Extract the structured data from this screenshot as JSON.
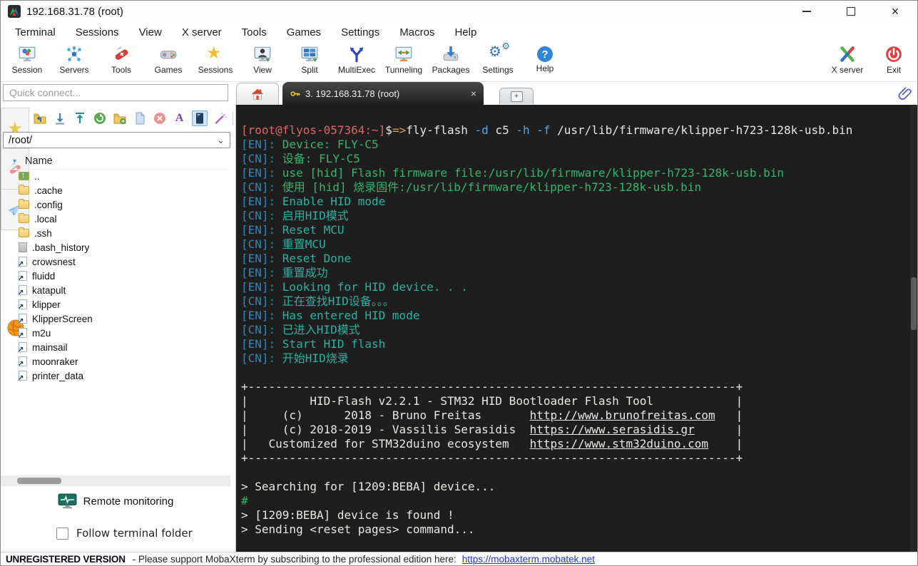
{
  "window": {
    "title": "192.168.31.78 (root)"
  },
  "icons": {
    "close_glyph": "×",
    "plus_glyph": "+",
    "sort_glyph": "▾",
    "chevron_glyph": "⌄",
    "star_glyph": "★",
    "gear_glyph": "⚙",
    "help_glyph": "?",
    "rename_glyph": "A"
  },
  "menu": {
    "items": [
      "Terminal",
      "Sessions",
      "View",
      "X server",
      "Tools",
      "Games",
      "Settings",
      "Macros",
      "Help"
    ]
  },
  "toolbar": {
    "items": [
      {
        "label": "Session"
      },
      {
        "label": "Servers"
      },
      {
        "label": "Tools"
      },
      {
        "label": "Games"
      },
      {
        "label": "Sessions"
      },
      {
        "label": "View"
      },
      {
        "label": "Split"
      },
      {
        "label": "MultiExec"
      },
      {
        "label": "Tunneling"
      },
      {
        "label": "Packages"
      },
      {
        "label": "Settings"
      },
      {
        "label": "Help"
      }
    ],
    "right_items": [
      {
        "label": "X server"
      },
      {
        "label": "Exit"
      }
    ]
  },
  "quick_connect": {
    "placeholder": "Quick connect..."
  },
  "tabs": {
    "active_label": "3. 192.168.31.78 (root)"
  },
  "sidebar": {
    "path": "/root/",
    "name_header": "Name",
    "files": [
      {
        "name": "..",
        "type": "parent"
      },
      {
        "name": ".cache",
        "type": "folder"
      },
      {
        "name": ".config",
        "type": "folder"
      },
      {
        "name": ".local",
        "type": "folder"
      },
      {
        "name": ".ssh",
        "type": "folder"
      },
      {
        "name": ".bash_history",
        "type": "file"
      },
      {
        "name": "crowsnest",
        "type": "link"
      },
      {
        "name": "fluidd",
        "type": "link"
      },
      {
        "name": "katapult",
        "type": "link"
      },
      {
        "name": "klipper",
        "type": "link"
      },
      {
        "name": "KlipperScreen",
        "type": "link"
      },
      {
        "name": "m2u",
        "type": "link"
      },
      {
        "name": "mainsail",
        "type": "link"
      },
      {
        "name": "moonraker",
        "type": "link"
      },
      {
        "name": "printer_data",
        "type": "link"
      }
    ],
    "remote_monitoring": "Remote monitoring",
    "follow_terminal_folder": "Follow terminal folder"
  },
  "terminal": {
    "colors": {
      "background": "#1e1e1e",
      "red": "#e0646c",
      "yellow": "#d4a45a",
      "blue": "#58a6e4",
      "label_blue": "#2e86b8",
      "green": "#35b56e",
      "teal": "#2ab3a0",
      "white": "#e8e8e3"
    },
    "lines": [
      [
        {
          "t": "[root@flyos-057364:~]",
          "c": "red"
        },
        {
          "t": "$",
          "c": "white"
        },
        {
          "t": "=>",
          "c": "yellow"
        },
        {
          "t": "fly-flash ",
          "c": "white"
        },
        {
          "t": "-d",
          "c": "blue"
        },
        {
          "t": " c5 ",
          "c": "white"
        },
        {
          "t": "-h",
          "c": "blue"
        },
        {
          "t": " ",
          "c": "white"
        },
        {
          "t": "-f",
          "c": "blue"
        },
        {
          "t": " /usr/lib/firmware/klipper-h723-128k-usb.bin",
          "c": "white"
        }
      ],
      [
        {
          "t": "[EN]: ",
          "c": "label"
        },
        {
          "t": "Device: FLY-C5",
          "c": "green"
        }
      ],
      [
        {
          "t": "[CN]: ",
          "c": "label"
        },
        {
          "t": "设备: FLY-C5",
          "c": "green"
        }
      ],
      [
        {
          "t": "[EN]: ",
          "c": "label"
        },
        {
          "t": "use [hid] Flash firmware file:/usr/lib/firmware/klipper-h723-128k-usb.bin",
          "c": "green"
        }
      ],
      [
        {
          "t": "[CN]: ",
          "c": "label"
        },
        {
          "t": "使用 [hid] 烧录固件:/usr/lib/firmware/klipper-h723-128k-usb.bin",
          "c": "green"
        }
      ],
      [
        {
          "t": "[EN]: ",
          "c": "label"
        },
        {
          "t": "Enable HID mode",
          "c": "teal"
        }
      ],
      [
        {
          "t": "[CN]: ",
          "c": "label"
        },
        {
          "t": "启用HID模式",
          "c": "teal"
        }
      ],
      [
        {
          "t": "[EN]: ",
          "c": "label"
        },
        {
          "t": "Reset MCU",
          "c": "teal"
        }
      ],
      [
        {
          "t": "[CN]: ",
          "c": "label"
        },
        {
          "t": "重置MCU",
          "c": "teal"
        }
      ],
      [
        {
          "t": "[EN]: ",
          "c": "label"
        },
        {
          "t": "Reset Done",
          "c": "teal"
        }
      ],
      [
        {
          "t": "[EN]: ",
          "c": "label"
        },
        {
          "t": "重置成功",
          "c": "teal"
        }
      ],
      [
        {
          "t": "[EN]: ",
          "c": "label"
        },
        {
          "t": "Looking for HID device. . .",
          "c": "teal"
        }
      ],
      [
        {
          "t": "[CN]: ",
          "c": "label"
        },
        {
          "t": "正在查找HID设备。。。",
          "c": "teal"
        }
      ],
      [
        {
          "t": "[EN]: ",
          "c": "label"
        },
        {
          "t": "Has entered HID mode",
          "c": "teal"
        }
      ],
      [
        {
          "t": "[CN]: ",
          "c": "label"
        },
        {
          "t": "已进入HID模式",
          "c": "teal"
        }
      ],
      [
        {
          "t": "[EN]: ",
          "c": "label"
        },
        {
          "t": "Start HID flash",
          "c": "teal"
        }
      ],
      [
        {
          "t": "[CN]: ",
          "c": "label"
        },
        {
          "t": "开始HID烧录",
          "c": "teal"
        }
      ],
      [],
      [
        {
          "t": "+-----------------------------------------------------------------------+",
          "c": "white"
        }
      ],
      [
        {
          "t": "|         HID-Flash v2.2.1 - STM32 HID Bootloader Flash Tool            |",
          "c": "white"
        }
      ],
      [
        {
          "t": "|     (c)      2018 - Bruno Freitas       ",
          "c": "white"
        },
        {
          "t": "http://www.brunofreitas.com",
          "c": "white",
          "u": true
        },
        {
          "t": "   |",
          "c": "white"
        }
      ],
      [
        {
          "t": "|     (c) 2018-2019 - Vassilis Serasidis  ",
          "c": "white"
        },
        {
          "t": "https://www.serasidis.gr",
          "c": "white",
          "u": true
        },
        {
          "t": "      |",
          "c": "white"
        }
      ],
      [
        {
          "t": "|   Customized for STM32duino ecosystem   ",
          "c": "white"
        },
        {
          "t": "https://www.stm32duino.com",
          "c": "white",
          "u": true
        },
        {
          "t": "    |",
          "c": "white"
        }
      ],
      [
        {
          "t": "+-----------------------------------------------------------------------+",
          "c": "white"
        }
      ],
      [],
      [
        {
          "t": "> Searching for [1209:BEBA] device...",
          "c": "white"
        }
      ],
      [
        {
          "t": "#",
          "c": "green"
        }
      ],
      [
        {
          "t": "> [1209:BEBA] device is found !",
          "c": "white"
        }
      ],
      [
        {
          "t": "> Sending <reset pages> command...",
          "c": "white"
        }
      ]
    ]
  },
  "statusbar": {
    "unregistered": "UNREGISTERED VERSION",
    "message": "-  Please support MobaXterm by subscribing to the professional edition here:",
    "link": "https://mobaxterm.mobatek.net"
  }
}
